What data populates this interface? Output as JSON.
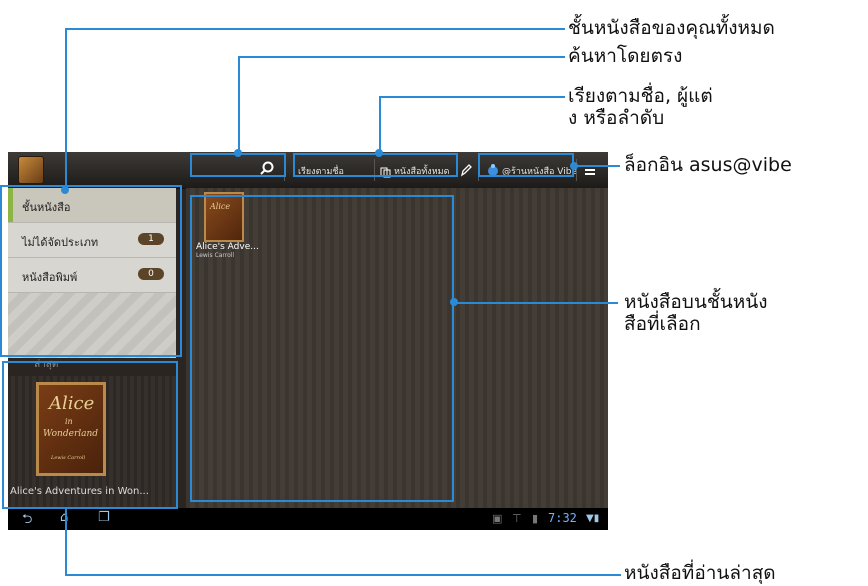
{
  "labels": {
    "all_books_shelf": "ชั้นหนังสือของคุณทั้งหมด",
    "direct_search": "ค้นหาโดยตรง",
    "sort_line1": "เรียงตามชื่อ, ผู้แต่",
    "sort_line2": "ง หรือลำดับ",
    "login": "ล็อกอิน asus@vibe",
    "books_on_shelf_line1": "หนังสือบนชั้นหนัง",
    "books_on_shelf_line2": "สือที่เลือก",
    "recent_book": "หนังสือที่อ่านล่าสุด"
  },
  "toolbar": {
    "sort_label": "เรียงตามชื่อ",
    "all_books_label": "หนังสือทั้งหมด",
    "store_label": "@ร้านหนังสือ Vibe"
  },
  "sidebar": {
    "items": [
      {
        "label": "ชั้นหนังสือ",
        "count": ""
      },
      {
        "label": "ไม่ได้จัดประเภท",
        "count": "1"
      },
      {
        "label": "หนังสือพิมพ์",
        "count": "0"
      }
    ],
    "recent_header": "ล่าสุด"
  },
  "recent": {
    "title": "Alice's Adventures in Won...",
    "cover_line1": "Alice",
    "cover_line2": "in",
    "cover_line3": "Wonderland",
    "cover_author": "Lewis Carroll"
  },
  "shelf": {
    "book_title": "Alice's Adve...",
    "book_author": "Lewis Carroll",
    "cover_text": "Alice"
  },
  "status": {
    "time": "7:32"
  },
  "icons": [
    "search-icon",
    "all-books-icon",
    "edit-icon",
    "store-icon",
    "menu-icon",
    "back-icon",
    "home-icon",
    "recent-apps-icon"
  ],
  "colors": {
    "callout": "#2a8ad6",
    "selected_accent": "#8cb545"
  }
}
